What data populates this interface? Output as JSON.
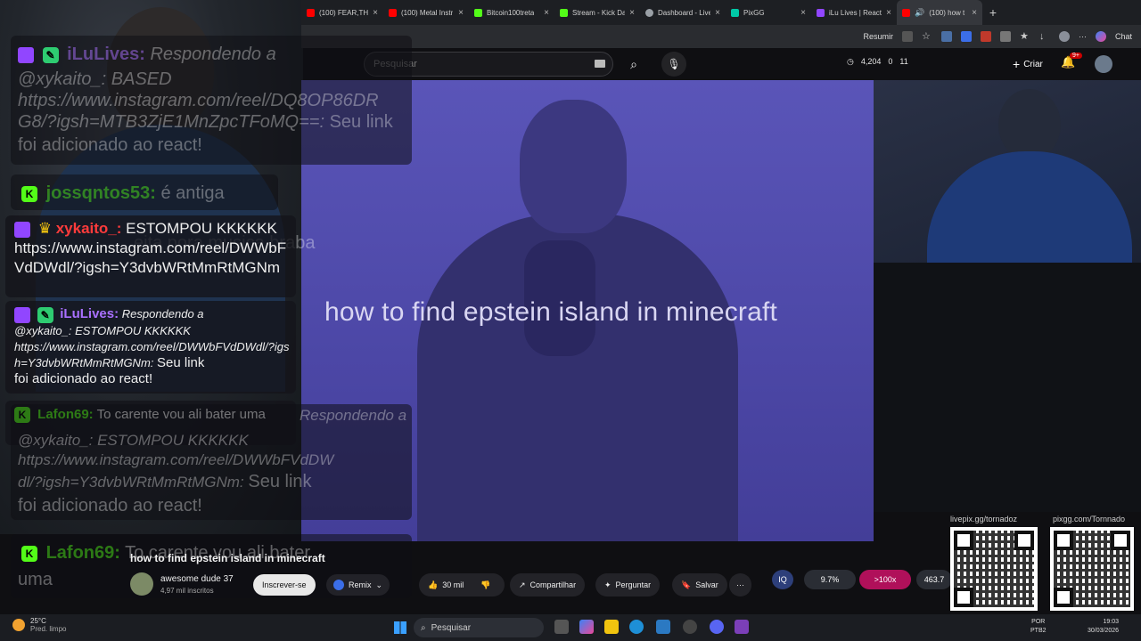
{
  "browser": {
    "tabs": [
      {
        "label": "(100) FEAR,THE",
        "color": "#ff0000"
      },
      {
        "label": "(100) Metal Instr",
        "color": "#ff0000"
      },
      {
        "label": "Bitcoin100treta",
        "color": "#53fc18"
      },
      {
        "label": "Stream - Kick Da",
        "color": "#53fc18"
      },
      {
        "label": "Dashboard - Live",
        "color": "#9aa0a6"
      },
      {
        "label": "PixGG",
        "color": "#00c9a7"
      },
      {
        "label": "iLu Lives | React",
        "color": "#9146ff"
      },
      {
        "label": "(100) how t",
        "color": "#ff0000",
        "active": true
      }
    ],
    "toolbar": {
      "resume": "Resumir",
      "chat": "Chat"
    }
  },
  "youtube": {
    "search_placeholder": "Pesquisar",
    "header_stats": {
      "views": "4,204",
      "a": "0",
      "b": "11"
    },
    "create_label": "Criar",
    "notifications": "9+",
    "video_caption": "how to find epstein island in minecraft",
    "video_title": "how to find epstein island in minecraft",
    "channel_name": "awesome dude 37",
    "channel_subs": "4,97 mil inscritos",
    "subscribe_label": "Inscrever-se",
    "remix_label": "Remix",
    "likes": "30 mil",
    "share_label": "Compartilhar",
    "ask_label": "Perguntar",
    "save_label": "Salvar",
    "more_label": "···"
  },
  "overlay": {
    "stats": {
      "pct": "9.7%",
      "mult": ">100x",
      "value": "463.7"
    },
    "qr_label_left": "livepix.gg/tornadoz",
    "qr_label_right": "pixgg.com/Tornnado"
  },
  "chat": {
    "ghost_lines": [
      {
        "user": "iLuLives:",
        "text": "Respondendo a"
      },
      {
        "text": "@xykaito_: BASED"
      },
      {
        "text": "https://www.instagram.com/reel/DQ8OP86DR"
      },
      {
        "text": "G8/?igsh=MTB3ZjE1MnZpcTFoMQ==:"
      },
      {
        "text": "Seu link"
      },
      {
        "text": "foi adicionado ao react!"
      },
      {
        "user": "jossqntos53:",
        "text": "é antiga"
      },
      {
        "text": "eita pora musica braba"
      }
    ],
    "messages": [
      {
        "user": "xykaito_:",
        "user_color": "#ff3b3b",
        "text": "ESTOMPOU KKKKKK",
        "body": "https://www.instagram.com/reel/DWWbFVdDWdl/?igsh=Y3dvbWRtMmRtMGNm"
      },
      {
        "user": "iLuLives:",
        "user_color": "#a970ff",
        "reply": "Respondendo a",
        "quote": "@xykaito_: ESTOMPOU KKKKKK",
        "link": "https://www.instagram.com/reel/DWWbFVdDWdl/?igsh=Y3dvbWRtMmRtMGNm:",
        "text": "Seu link",
        "text2": "foi adicionado ao react!"
      },
      {
        "user": "Lafon69:",
        "user_color": "#53fc18",
        "text": "To carente vou ali bater uma"
      }
    ],
    "ghost_bottom": {
      "reply": "Respondendo a",
      "quote": "@xykaito_: ESTOMPOU KKKKKK",
      "link1": "https://www.instagram.com/reel/DWWbFVdDW",
      "link2": "dl/?igsh=Y3dvbWRtMmRtMGNm:",
      "text": "Seu link",
      "text2": "foi adicionado ao react!",
      "user": "Lafon69:",
      "user_text": "To carente vou ali bater",
      "user_text2": "uma"
    }
  },
  "taskbar": {
    "temp": "25°C",
    "weather": "Pred. limpo",
    "search": "Pesquisar",
    "lang1": "POR",
    "lang2": "PTB2",
    "time": "19:03",
    "date": "30/03/2026"
  }
}
